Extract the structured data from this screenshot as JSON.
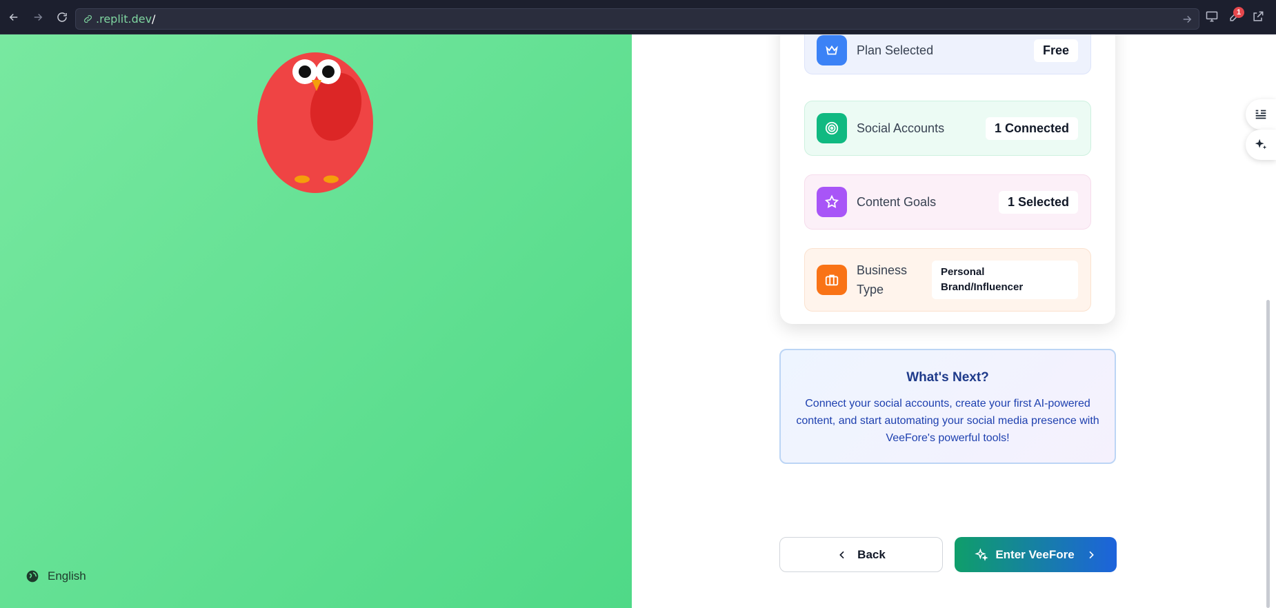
{
  "browser": {
    "url_host": ".replit.dev",
    "url_path": "/",
    "notification_count": "1"
  },
  "left": {
    "language": "English"
  },
  "summary": {
    "rows": [
      {
        "label": "Plan Selected",
        "value": "Free"
      },
      {
        "label": "Social Accounts",
        "value": "1 Connected"
      },
      {
        "label": "Content Goals",
        "value": "1 Selected"
      },
      {
        "label": "Business Type",
        "value": "Personal Brand/Influencer"
      }
    ]
  },
  "next": {
    "title": "What's Next?",
    "body": "Connect your social accounts, create your first AI-powered content, and start automating your social media presence with VeeFore's powerful tools!"
  },
  "actions": {
    "back_label": "Back",
    "enter_label": "Enter VeeFore"
  },
  "colors": {
    "plan_icon": "#3b82f6",
    "social_icon": "#10b981",
    "goals_icon": "#a855f7",
    "business_icon": "#f97316",
    "left_panel": "#5fdf8f"
  }
}
